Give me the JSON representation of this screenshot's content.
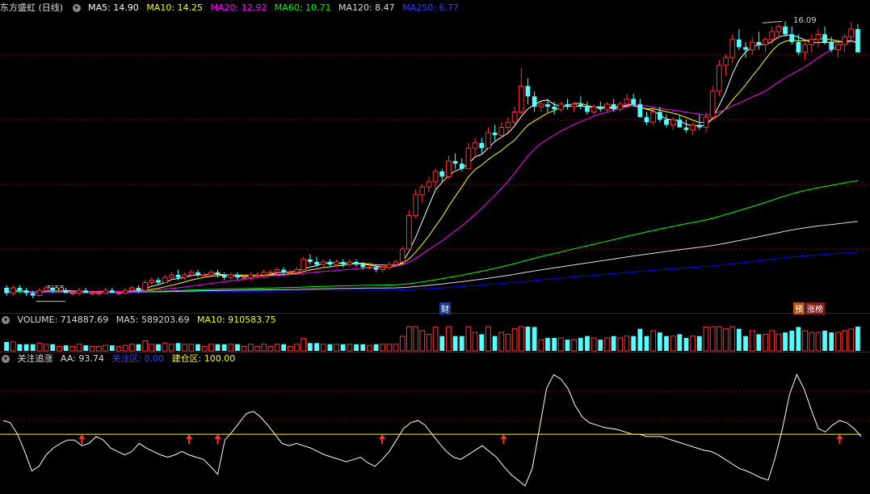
{
  "main_header": {
    "title": "东方盛虹 (日线)",
    "items": [
      {
        "label": "MA5: 14.90",
        "color": "#ffffff"
      },
      {
        "label": "MA10: 14.25",
        "color": "#ffff00"
      },
      {
        "label": "MA20: 12.92",
        "color": "#ff00ff"
      },
      {
        "label": "MA60: 10.71",
        "color": "#00ff00"
      },
      {
        "label": "MA120: 8.47",
        "color": "#dddddd"
      },
      {
        "label": "MA250: 6.77",
        "color": "#0000ff"
      }
    ]
  },
  "price_annotations": {
    "high": "16.09",
    "low": "5.55"
  },
  "event_markers": {
    "cai": "财",
    "yu": "预",
    "zhangting": "涨榜"
  },
  "volume_header": {
    "items": [
      {
        "label": "VOLUME: 714887.69",
        "color": "#dddddd"
      },
      {
        "label": "MA5: 589203.69",
        "color": "#dddddd"
      },
      {
        "label": "MA10: 910583.75",
        "color": "#ffff00"
      }
    ]
  },
  "indicator_header": {
    "items": [
      {
        "label": "关注追涨",
        "color": "#dddddd"
      },
      {
        "label": "AA: 93.74",
        "color": "#dddddd"
      },
      {
        "label": "关注区: 0.00",
        "color": "#0000ff"
      },
      {
        "label": "建仓区: 100.00",
        "color": "#ffff00"
      }
    ]
  },
  "colors": {
    "up": "#ff3030",
    "down": "#54ffff",
    "grid": "#8b0000"
  },
  "chart_data": {
    "type": "candlestick",
    "ma_colors": [
      "#ffffff",
      "#ffff00",
      "#ff00ff",
      "#00ff00",
      "#dddddd",
      "#0000ff"
    ],
    "ohlc": [
      [
        5.8,
        5.9,
        5.5,
        5.6
      ],
      [
        5.6,
        5.9,
        5.5,
        5.8
      ],
      [
        5.8,
        5.9,
        5.6,
        5.7
      ],
      [
        5.7,
        5.8,
        5.5,
        5.6
      ],
      [
        5.6,
        5.7,
        5.4,
        5.5
      ],
      [
        5.5,
        5.8,
        5.5,
        5.7
      ],
      [
        5.7,
        5.9,
        5.6,
        5.8
      ],
      [
        5.8,
        5.9,
        5.6,
        5.7
      ],
      [
        5.7,
        5.8,
        5.6,
        5.7
      ],
      [
        5.7,
        5.8,
        5.6,
        5.6
      ],
      [
        5.6,
        5.7,
        5.5,
        5.6
      ],
      [
        5.6,
        5.8,
        5.5,
        5.7
      ],
      [
        5.7,
        5.8,
        5.6,
        5.6
      ],
      [
        5.6,
        5.7,
        5.5,
        5.6
      ],
      [
        5.6,
        5.7,
        5.5,
        5.6
      ],
      [
        5.6,
        5.8,
        5.6,
        5.7
      ],
      [
        5.7,
        5.8,
        5.6,
        5.6
      ],
      [
        5.6,
        5.7,
        5.5,
        5.6
      ],
      [
        5.6,
        5.8,
        5.6,
        5.7
      ],
      [
        5.7,
        5.9,
        5.6,
        5.8
      ],
      [
        5.8,
        5.9,
        5.6,
        5.7
      ],
      [
        5.7,
        6.1,
        5.7,
        6.0
      ],
      [
        6.0,
        6.2,
        5.9,
        6.1
      ],
      [
        6.1,
        6.2,
        5.9,
        6.0
      ],
      [
        6.0,
        6.3,
        6.0,
        6.2
      ],
      [
        6.2,
        6.4,
        6.1,
        6.3
      ],
      [
        6.3,
        6.5,
        6.1,
        6.2
      ],
      [
        6.2,
        6.4,
        6.1,
        6.3
      ],
      [
        6.3,
        6.5,
        6.2,
        6.4
      ],
      [
        6.4,
        6.5,
        6.2,
        6.3
      ],
      [
        6.3,
        6.4,
        6.2,
        6.3
      ],
      [
        6.3,
        6.5,
        6.2,
        6.4
      ],
      [
        6.4,
        6.5,
        6.2,
        6.3
      ],
      [
        6.3,
        6.4,
        6.1,
        6.2
      ],
      [
        6.2,
        6.4,
        6.1,
        6.3
      ],
      [
        6.3,
        6.4,
        6.1,
        6.2
      ],
      [
        6.2,
        6.3,
        6.1,
        6.2
      ],
      [
        6.2,
        6.4,
        6.1,
        6.3
      ],
      [
        6.3,
        6.4,
        6.2,
        6.3
      ],
      [
        6.3,
        6.5,
        6.2,
        6.4
      ],
      [
        6.4,
        6.5,
        6.3,
        6.4
      ],
      [
        6.4,
        6.6,
        6.3,
        6.5
      ],
      [
        6.5,
        6.6,
        6.3,
        6.4
      ],
      [
        6.4,
        6.5,
        6.3,
        6.4
      ],
      [
        6.4,
        6.6,
        6.3,
        6.5
      ],
      [
        6.5,
        7.0,
        6.5,
        6.9
      ],
      [
        6.9,
        7.1,
        6.7,
        6.8
      ],
      [
        6.8,
        7.0,
        6.6,
        6.7
      ],
      [
        6.7,
        6.9,
        6.6,
        6.8
      ],
      [
        6.8,
        6.9,
        6.6,
        6.7
      ],
      [
        6.7,
        6.9,
        6.6,
        6.8
      ],
      [
        6.8,
        6.9,
        6.6,
        6.7
      ],
      [
        6.7,
        6.9,
        6.6,
        6.8
      ],
      [
        6.8,
        6.9,
        6.6,
        6.7
      ],
      [
        6.7,
        6.8,
        6.5,
        6.6
      ],
      [
        6.6,
        6.8,
        6.5,
        6.6
      ],
      [
        6.6,
        6.7,
        6.4,
        6.5
      ],
      [
        6.5,
        6.7,
        6.4,
        6.6
      ],
      [
        6.6,
        6.8,
        6.5,
        6.7
      ],
      [
        6.7,
        6.9,
        6.6,
        6.8
      ],
      [
        6.8,
        7.4,
        6.8,
        7.3
      ],
      [
        7.3,
        8.8,
        7.3,
        8.6
      ],
      [
        8.6,
        9.6,
        8.5,
        9.4
      ],
      [
        9.4,
        9.8,
        9.1,
        9.7
      ],
      [
        9.7,
        10.1,
        9.5,
        9.9
      ],
      [
        9.9,
        10.4,
        9.6,
        10.3
      ],
      [
        10.3,
        10.4,
        9.9,
        10.1
      ],
      [
        10.1,
        10.9,
        10.0,
        10.7
      ],
      [
        10.7,
        11.0,
        10.4,
        10.6
      ],
      [
        10.6,
        10.8,
        10.3,
        10.4
      ],
      [
        10.4,
        11.4,
        10.4,
        11.2
      ],
      [
        11.2,
        11.6,
        10.9,
        11.4
      ],
      [
        11.4,
        11.6,
        11.0,
        11.2
      ],
      [
        11.2,
        12.0,
        11.2,
        11.8
      ],
      [
        11.8,
        12.1,
        11.5,
        11.7
      ],
      [
        11.7,
        12.2,
        11.6,
        12.0
      ],
      [
        12.0,
        12.4,
        11.8,
        12.2
      ],
      [
        12.2,
        12.8,
        12.1,
        12.6
      ],
      [
        12.6,
        14.3,
        12.5,
        13.6
      ],
      [
        13.6,
        13.9,
        12.9,
        13.2
      ],
      [
        13.2,
        13.4,
        12.6,
        12.8
      ],
      [
        12.8,
        13.0,
        12.6,
        12.9
      ],
      [
        12.9,
        13.1,
        12.6,
        12.8
      ],
      [
        12.8,
        13.0,
        12.5,
        12.7
      ],
      [
        12.7,
        13.0,
        12.6,
        12.9
      ],
      [
        12.9,
        13.1,
        12.7,
        12.8
      ],
      [
        12.8,
        13.0,
        12.6,
        12.9
      ],
      [
        12.9,
        13.2,
        12.7,
        12.8
      ],
      [
        12.8,
        13.0,
        12.5,
        12.6
      ],
      [
        12.6,
        12.9,
        12.5,
        12.8
      ],
      [
        12.8,
        13.0,
        12.6,
        12.7
      ],
      [
        12.7,
        13.0,
        12.6,
        12.9
      ],
      [
        12.9,
        13.1,
        12.6,
        12.7
      ],
      [
        12.7,
        13.0,
        12.6,
        12.9
      ],
      [
        12.9,
        13.3,
        12.8,
        13.1
      ],
      [
        13.1,
        13.3,
        12.8,
        12.9
      ],
      [
        12.9,
        13.1,
        12.5,
        12.4
      ],
      [
        12.4,
        12.6,
        12.1,
        12.2
      ],
      [
        12.2,
        12.7,
        12.1,
        12.6
      ],
      [
        12.6,
        12.8,
        12.2,
        12.3
      ],
      [
        12.3,
        12.5,
        12.0,
        12.1
      ],
      [
        12.1,
        12.4,
        11.9,
        12.3
      ],
      [
        12.3,
        12.5,
        12.0,
        12.0
      ],
      [
        12.0,
        12.3,
        11.8,
        11.9
      ],
      [
        11.9,
        12.2,
        11.7,
        12.1
      ],
      [
        12.1,
        12.5,
        11.9,
        12.0
      ],
      [
        12.0,
        12.6,
        11.8,
        12.4
      ],
      [
        12.4,
        13.6,
        12.3,
        13.4
      ],
      [
        13.4,
        14.6,
        13.2,
        14.4
      ],
      [
        14.4,
        14.8,
        14.0,
        14.7
      ],
      [
        14.7,
        15.6,
        14.5,
        15.4
      ],
      [
        15.4,
        15.8,
        15.0,
        15.1
      ],
      [
        15.1,
        15.3,
        14.7,
        15.0
      ],
      [
        15.0,
        15.5,
        14.8,
        15.3
      ],
      [
        15.3,
        15.7,
        15.0,
        15.2
      ],
      [
        15.2,
        15.5,
        14.9,
        15.4
      ],
      [
        15.4,
        15.9,
        15.2,
        15.7
      ],
      [
        15.7,
        16.0,
        15.4,
        15.9
      ],
      [
        15.9,
        16.1,
        15.5,
        15.6
      ],
      [
        15.6,
        15.9,
        15.2,
        15.3
      ],
      [
        15.3,
        15.6,
        14.8,
        14.9
      ],
      [
        14.9,
        15.3,
        14.6,
        15.2
      ],
      [
        15.2,
        15.6,
        14.9,
        15.4
      ],
      [
        15.4,
        15.8,
        15.1,
        15.6
      ],
      [
        15.6,
        15.9,
        15.2,
        15.3
      ],
      [
        15.3,
        15.5,
        14.9,
        15.0
      ],
      [
        15.0,
        15.4,
        14.7,
        15.2
      ],
      [
        15.2,
        15.6,
        14.9,
        15.5
      ],
      [
        15.5,
        16.09,
        15.3,
        15.8
      ],
      [
        15.8,
        16.0,
        15.0,
        14.9
      ]
    ],
    "y_range": [
      5.3,
      16.3
    ],
    "volume_range": [
      0,
      900000
    ],
    "indicator_range": [
      0,
      110
    ],
    "indicator_level": 50,
    "indicator_values": [
      62,
      60,
      50,
      35,
      18,
      22,
      32,
      38,
      42,
      45,
      45,
      40,
      42,
      48,
      45,
      38,
      35,
      32,
      35,
      42,
      38,
      35,
      32,
      30,
      32,
      35,
      32,
      30,
      28,
      22,
      15,
      45,
      52,
      60,
      68,
      70,
      65,
      58,
      50,
      42,
      40,
      42,
      40,
      38,
      35,
      32,
      30,
      28,
      26,
      28,
      30,
      25,
      22,
      28,
      35,
      45,
      55,
      60,
      62,
      58,
      50,
      42,
      35,
      30,
      28,
      32,
      36,
      40,
      35,
      30,
      22,
      15,
      10,
      5,
      20,
      55,
      90,
      102,
      98,
      90,
      75,
      65,
      60,
      58,
      56,
      55,
      54,
      52,
      50,
      50,
      48,
      48,
      48,
      46,
      44,
      42,
      40,
      38,
      36,
      35,
      32,
      28,
      24,
      20,
      18,
      15,
      12,
      10,
      30,
      55,
      85,
      102,
      90,
      72,
      55,
      52,
      58,
      62,
      60,
      55,
      48
    ],
    "indicator_arrows": [
      11,
      26,
      30,
      53,
      70,
      117
    ]
  }
}
